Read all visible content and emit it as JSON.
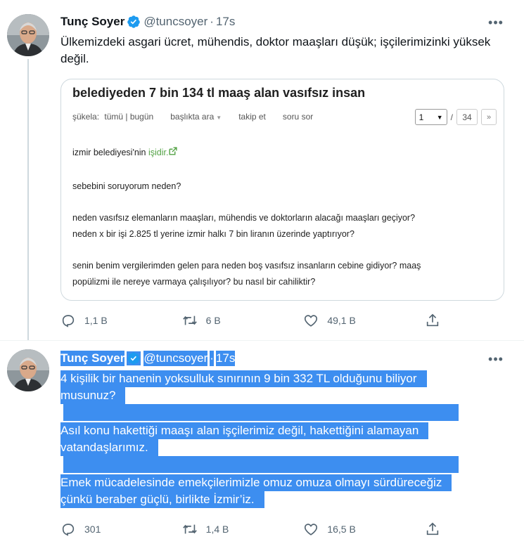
{
  "tweet1": {
    "author_name": "Tunç Soyer",
    "handle": "@tuncsoyer",
    "dot": "·",
    "time": "17s",
    "text": "Ülkemizdeki asgari ücret, mühendis, doktor maaşları düşük; işçilerimizinki yüksek değil.",
    "quoted_card": {
      "title": "belediyeden 7 bin 134 tl maaş alan vasıfsız insan",
      "subnav": {
        "sukela": "şükela:",
        "filter": "tümü | bugün",
        "search": "başlıkta ara",
        "follow": "takip et",
        "ask": "soru sor"
      },
      "pager": {
        "current": "1",
        "separator": "/",
        "total": "34",
        "next": "»"
      },
      "entry": {
        "p1_prefix": "izmir belediyesi'nin",
        "p1_link": "işidir.",
        "p2": "sebebini soruyorum neden?",
        "p3_l1": "neden vasıfsız elemanların maaşları, mühendis ve doktorların alacağı maaşları geçiyor?",
        "p3_l2": "neden x bir işi 2.825 tl yerine izmir halkı 7 bin liranın üzerinde yaptırıyor?",
        "p4_l1": "senin benim vergilerimden gelen para neden boş vasıfsız insanların cebine gidiyor? maaş",
        "p4_l2": "popülizmi ile nereye varmaya çalışılıyor? bu nasıl bir cahiliktir?"
      }
    },
    "actions": {
      "replies": "1,1 B",
      "retweets": "6 B",
      "likes": "49,1 B"
    }
  },
  "tweet2": {
    "author_name": "Tunç Soyer",
    "handle": "@tuncsoyer",
    "dot": "·",
    "time": "17s",
    "lines": {
      "l1": "4 kişilik bir hanenin yoksulluk sınırının 9 bin 332 TL olduğunu biliyor",
      "l2": "musunuz?",
      "l3": "Asıl konu hakettiği maaşı alan işçilerimiz değil, hakettiğini alamayan",
      "l4": "vatandaşlarımız.",
      "l5": "Emek mücadelesinde emekçilerimizle omuz omuza olmayı sürdüreceğiz",
      "l6": "çünkü beraber güçlü, birlikte İzmir’iz."
    },
    "actions": {
      "replies": "301",
      "retweets": "1,4 B",
      "likes": "16,5 B"
    }
  },
  "colors": {
    "selection": "#3d8ef0",
    "verified": "#1d9bf0",
    "muted": "#536471",
    "link_green": "#53a245"
  },
  "icons": [
    "verified-badge-icon",
    "more-icon",
    "reply-icon",
    "retweet-icon",
    "like-icon",
    "share-icon",
    "external-link-icon",
    "caret-down-icon"
  ]
}
